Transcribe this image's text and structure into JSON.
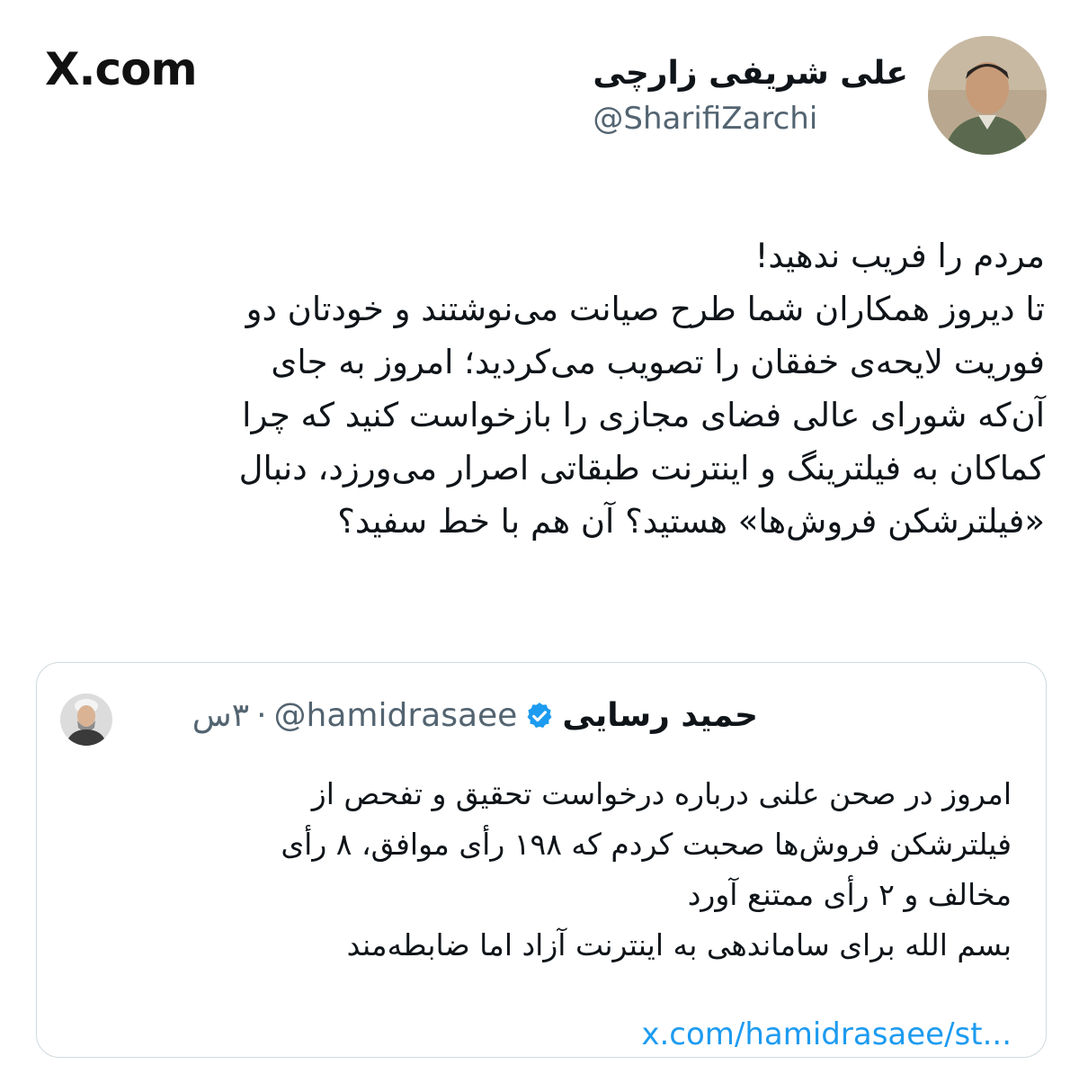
{
  "brand": "X.com",
  "author": {
    "name": "علی شریفی زارچی",
    "handle": "@SharifiZarchi"
  },
  "tweet": {
    "lines": [
      "مردم را فریب ندهید!",
      "تا دیروز همکاران شما طرح صیانت می‌نوشتند و خودتان دو",
      "فوریت لایحه‌ی خفقان را تصویب می‌کردید؛ امروز به جای",
      "آن‌که شورای عالی فضای مجازی را بازخواست کنید که چرا",
      "کماکان به فیلترینگ و اینترنت طبقاتی اصرار می‌ورزد، دنبال",
      "«فیلترشکن فروش‌ها» هستید؟ آن هم با خط سفید؟"
    ]
  },
  "quote": {
    "name": "حمید رسایی",
    "handle": "@hamidrasaee",
    "separator": "·",
    "time": "۳س",
    "lines": [
      "امروز در صحن علنی درباره درخواست تحقیق و تفحص از",
      "فیلترشکن فروش‌ها صحبت کردم که ۱۹۸ رأی موافق، ۸ رأی",
      "مخالف و ۲ رأی  ممتنع آورد",
      "بسم الله برای ساماندهی به اینترنت آزاد اما ضابطه‌مند"
    ],
    "link": "x.com/hamidrasaee/st..."
  },
  "colors": {
    "text": "#0f1419",
    "secondary": "#536471",
    "link": "#1d9bf0",
    "border": "#cfd9de",
    "verified": "#1d9bf0"
  }
}
